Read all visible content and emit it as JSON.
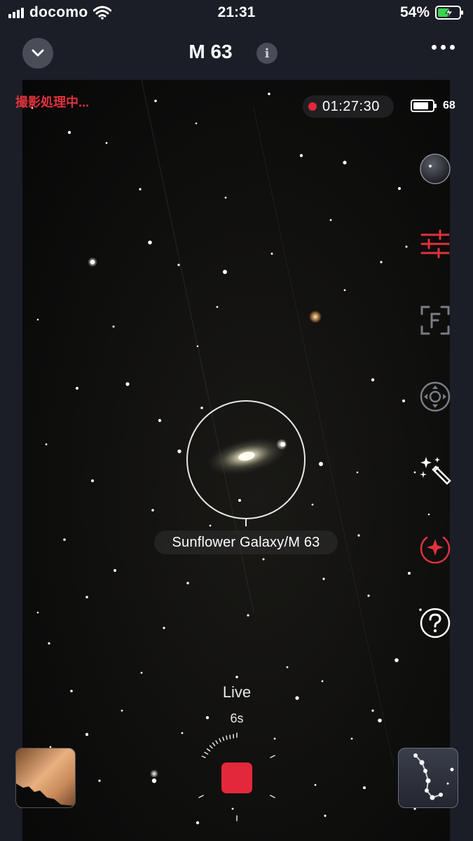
{
  "status_bar": {
    "carrier": "docomo",
    "time": "21:31",
    "battery_percent": "54%"
  },
  "nav": {
    "title": "M 63",
    "info_glyph": "i"
  },
  "capture": {
    "status_text": "撮影処理中...",
    "elapsed_time": "01:27:30",
    "device_battery": "68"
  },
  "toolbar": {
    "items": [
      {
        "name": "lens-cap-icon"
      },
      {
        "name": "adjust-sliders-icon",
        "color": "#e0323d"
      },
      {
        "name": "focus-icon"
      },
      {
        "name": "move-control-icon"
      },
      {
        "name": "magic-wand-icon"
      },
      {
        "name": "sparkle-target-icon",
        "color": "#e0323d"
      },
      {
        "name": "help-icon"
      }
    ]
  },
  "target": {
    "label": "Sunflower Galaxy/M 63"
  },
  "shooting": {
    "mode": "Live",
    "exposure": "6s"
  },
  "colors": {
    "accent_red": "#e3283a",
    "background": "#1b1d27"
  }
}
